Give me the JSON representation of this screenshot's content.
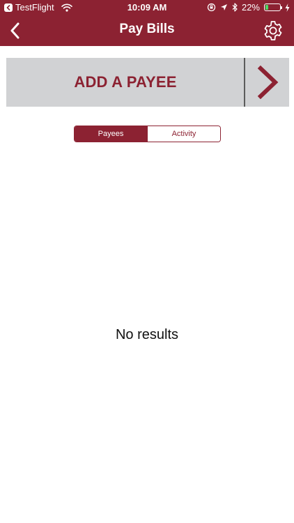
{
  "status_bar": {
    "back_app": "TestFlight",
    "time": "10:09 AM",
    "battery": "22%",
    "battery_level": 0.22,
    "icons": [
      "wifi-icon",
      "lock-rotation-icon",
      "location-arrow-icon",
      "bluetooth-icon",
      "battery-icon",
      "charging-icon"
    ]
  },
  "nav": {
    "title": "Pay Bills",
    "back_icon": "chevron-left-icon",
    "settings_icon": "gear-icon"
  },
  "banner": {
    "label": "ADD A PAYEE",
    "chevron_icon": "chevron-right-icon"
  },
  "tabs": [
    {
      "label": "Payees",
      "selected": true
    },
    {
      "label": "Activity",
      "selected": false
    }
  ],
  "empty_state": "No results",
  "colors": {
    "brand": "#8c2232",
    "banner_bg": "#d1d2d4",
    "battery_fill": "#4cd964"
  }
}
